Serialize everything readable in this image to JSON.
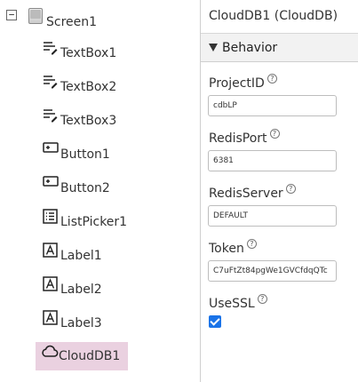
{
  "tree": {
    "collapse_glyph": "−",
    "screen": {
      "label": "Screen1",
      "icon": "screen-icon"
    },
    "components": [
      {
        "label": "TextBox1",
        "icon": "textbox-icon"
      },
      {
        "label": "TextBox2",
        "icon": "textbox-icon"
      },
      {
        "label": "TextBox3",
        "icon": "textbox-icon"
      },
      {
        "label": "Button1",
        "icon": "button-icon"
      },
      {
        "label": "Button2",
        "icon": "button-icon"
      },
      {
        "label": "ListPicker1",
        "icon": "listpicker-icon"
      },
      {
        "label": "Label1",
        "icon": "label-icon"
      },
      {
        "label": "Label2",
        "icon": "label-icon"
      },
      {
        "label": "Label3",
        "icon": "label-icon"
      },
      {
        "label": "CloudDB1",
        "icon": "cloud-icon",
        "selected": true
      }
    ],
    "selected_color": "#ead1e0"
  },
  "properties": {
    "title": "CloudDB1 (CloudDB)",
    "section": "Behavior",
    "help_glyph": "?",
    "fields": [
      {
        "label": "ProjectID",
        "value": "cdbLP"
      },
      {
        "label": "RedisPort",
        "value": "6381"
      },
      {
        "label": "RedisServer",
        "value": "DEFAULT"
      },
      {
        "label": "Token",
        "value": "C7uFtZt84pgWe1GVCfdqQTc"
      }
    ],
    "ssl": {
      "label": "UseSSL",
      "checked": true
    },
    "accent_color": "#1a73e8"
  }
}
